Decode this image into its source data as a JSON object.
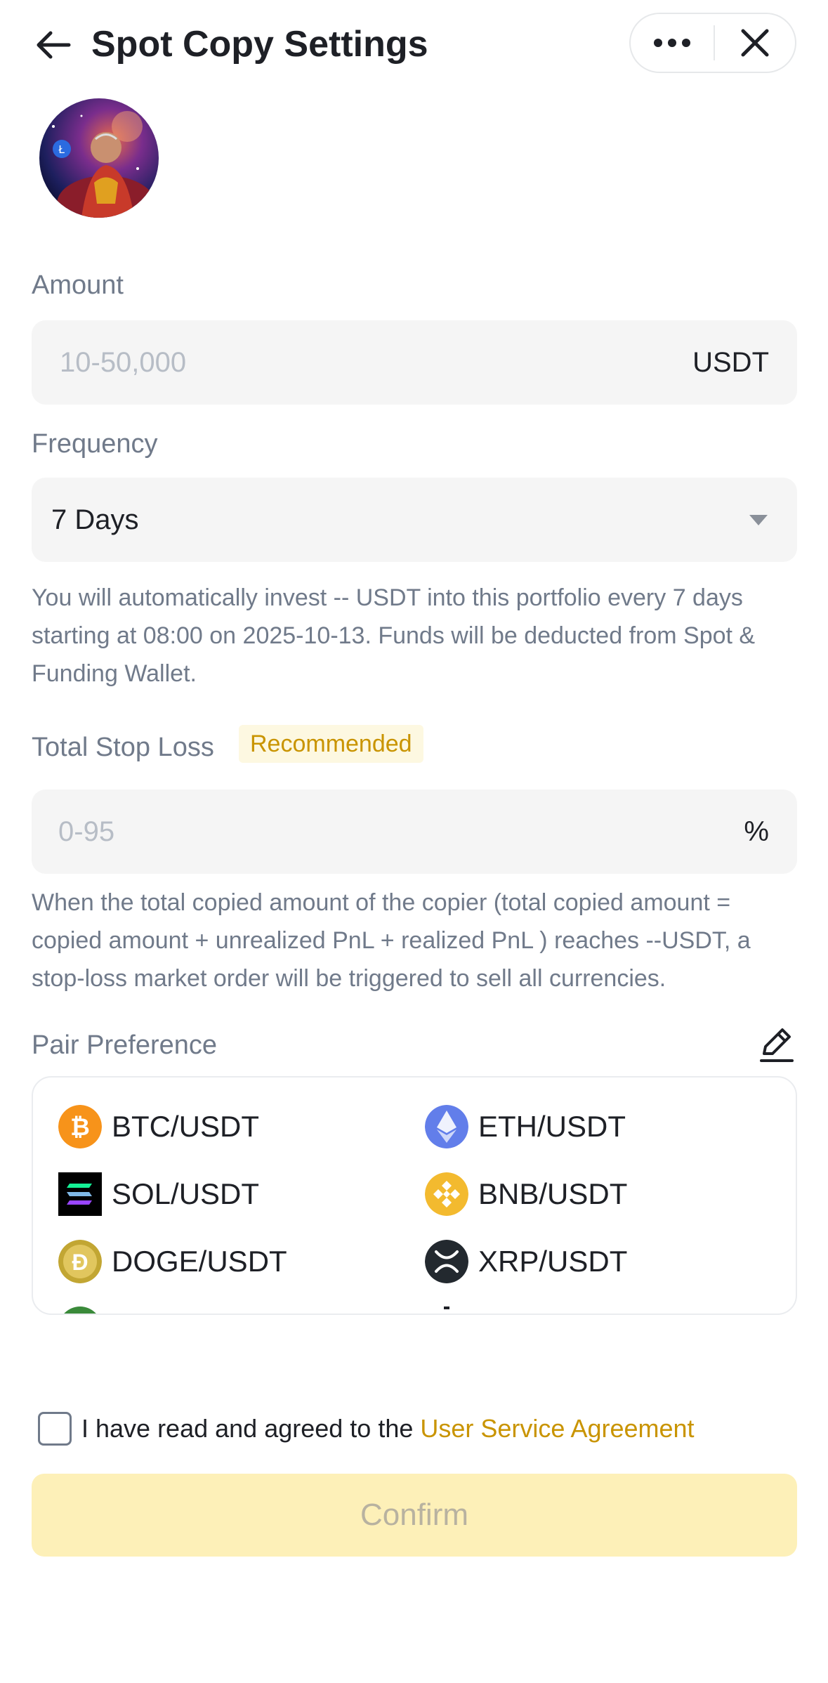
{
  "header": {
    "title": "Spot Copy Settings"
  },
  "amount": {
    "label": "Amount",
    "placeholder": "10-50,000",
    "unit": "USDT"
  },
  "frequency": {
    "label": "Frequency",
    "selected": "7 Days",
    "description": "You will automatically invest -- USDT into this portfolio every 7 days starting at 08:00 on 2025-10-13. Funds will be deducted from Spot & Funding Wallet."
  },
  "stop_loss": {
    "label": "Total Stop Loss",
    "badge": "Recommended",
    "placeholder": "0-95",
    "unit": "%",
    "description": "When the total copied amount of the copier (total copied amount = copied amount + unrealized PnL + realized PnL ) reaches --USDT, a stop-loss market order will be triggered to sell all currencies."
  },
  "pair_preference": {
    "label": "Pair Preference",
    "pairs": [
      "BTC/USDT",
      "ETH/USDT",
      "SOL/USDT",
      "BNB/USDT",
      "DOGE/USDT",
      "XRP/USDT"
    ]
  },
  "agreement": {
    "text": "I have read and agreed to the ",
    "link": "User Service Agreement"
  },
  "confirm_label": "Confirm",
  "colors": {
    "accent": "#c99400",
    "confirm_bg": "#fdf0b8",
    "field_bg": "#f5f5f5"
  }
}
